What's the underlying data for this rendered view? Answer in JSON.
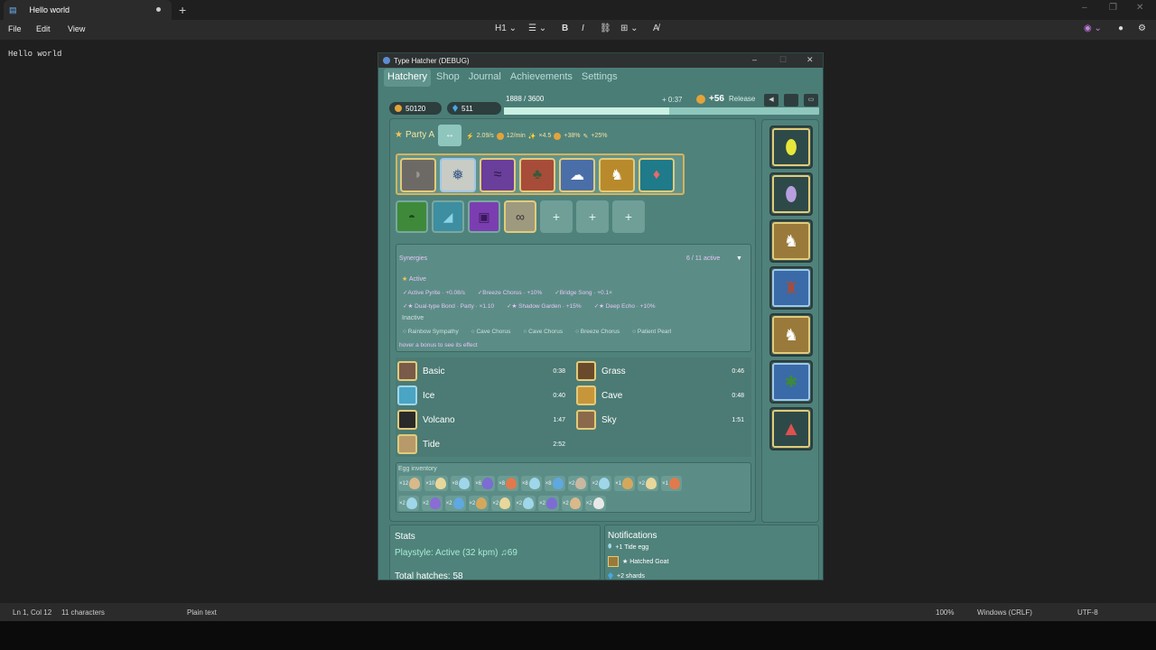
{
  "notepad": {
    "tab_title": "Hello world",
    "menu": [
      "File",
      "Edit",
      "View"
    ],
    "toolbar": {
      "heading": "H1",
      "bold": "B",
      "italic": "I"
    },
    "content": "Hello world",
    "status": {
      "position": "Ln 1, Col 12",
      "chars": "11 characters",
      "format": "Plain text",
      "zoom": "100%",
      "eol": "Windows (CRLF)",
      "enc": "UTF-8"
    }
  },
  "game": {
    "title": "Type Hatcher (DEBUG)",
    "nav": [
      "Hatchery",
      "Shop",
      "Journal",
      "Achievements",
      "Settings"
    ],
    "coins": "50120",
    "gems": "511",
    "progress_label": "1888 / 3600",
    "progress_fraction": 0.524,
    "timer": "+ 0:37",
    "income": "+56",
    "release": "Release",
    "party": {
      "name": "Party A",
      "toggle": "↔",
      "rate": "2.09/s",
      "per_min": "12/min",
      "bonus1": "×4.5",
      "bonus2": "+38%",
      "bonus3": "+25%"
    },
    "add_slot": "+",
    "synergies": {
      "title": "Synergies",
      "count": "6 / 11 active",
      "active_label": "Active",
      "active_row1": [
        "✓Active Pyrite · +0.08/s",
        "✓Breeze Chorus · +10%",
        "✓Bridge Song · +0.1×"
      ],
      "active_row2": [
        "✓★ Dual-type Bond · Party · ×1.10",
        "✓★ Shadow Garden · +15%",
        "✓★ Deep Echo · +10%"
      ],
      "inactive_label": "Inactive",
      "inactive": [
        "○ Rainbow Sympathy",
        "○ Cave Chorus",
        "○ Cave Chorus",
        "○ Breeze Chorus",
        "○ Patient Pearl"
      ],
      "hint": "hover a bonus to see its effect"
    },
    "habitats": [
      {
        "name": "Basic",
        "time": "0:38"
      },
      {
        "name": "Grass",
        "time": "0:46"
      },
      {
        "name": "Ice",
        "time": "0:40"
      },
      {
        "name": "Cave",
        "time": "0:48"
      },
      {
        "name": "Volcano",
        "time": "1:47"
      },
      {
        "name": "Sky",
        "time": "1:51"
      },
      {
        "name": "Tide",
        "time": "2:52"
      }
    ],
    "inventory_label": "Egg inventory",
    "inv_row1": [
      {
        "n": "×12",
        "c": "#d9b98a"
      },
      {
        "n": "×10",
        "c": "#e8d79a"
      },
      {
        "n": "×8",
        "c": "#9fd6ea"
      },
      {
        "n": "×6",
        "c": "#7c6cd4"
      },
      {
        "n": "×8",
        "c": "#e07a4c"
      },
      {
        "n": "×8",
        "c": "#9fd6ea"
      },
      {
        "n": "×8",
        "c": "#5fa8e0"
      },
      {
        "n": "×2",
        "c": "#c8b8a0"
      },
      {
        "n": "×2",
        "c": "#9fd6ea"
      },
      {
        "n": "×1",
        "c": "#d4a85c"
      },
      {
        "n": "×2",
        "c": "#e8d79a"
      },
      {
        "n": "×1",
        "c": "#e07a4c"
      }
    ],
    "inv_row2": [
      {
        "n": "×2",
        "c": "#9fd6ea"
      },
      {
        "n": "×2",
        "c": "#8a6cd4"
      },
      {
        "n": "×2",
        "c": "#5fa8e0"
      },
      {
        "n": "×2",
        "c": "#d4a85c"
      },
      {
        "n": "×2",
        "c": "#e8d79a"
      },
      {
        "n": "×2",
        "c": "#9fd6ea"
      },
      {
        "n": "×2",
        "c": "#7c6cd4"
      },
      {
        "n": "×2",
        "c": "#d9b98a"
      },
      {
        "n": "×2",
        "c": "#e8e8e8"
      }
    ],
    "stats": {
      "title": "Stats",
      "playstyle": "Playstyle: Active (32 kpm) ♫69",
      "total": "Total hatches: 58"
    },
    "notifications": {
      "title": "Notifications",
      "items": [
        "+1 Tide egg",
        "★ Hatched Goat",
        "+2 shards"
      ]
    }
  }
}
